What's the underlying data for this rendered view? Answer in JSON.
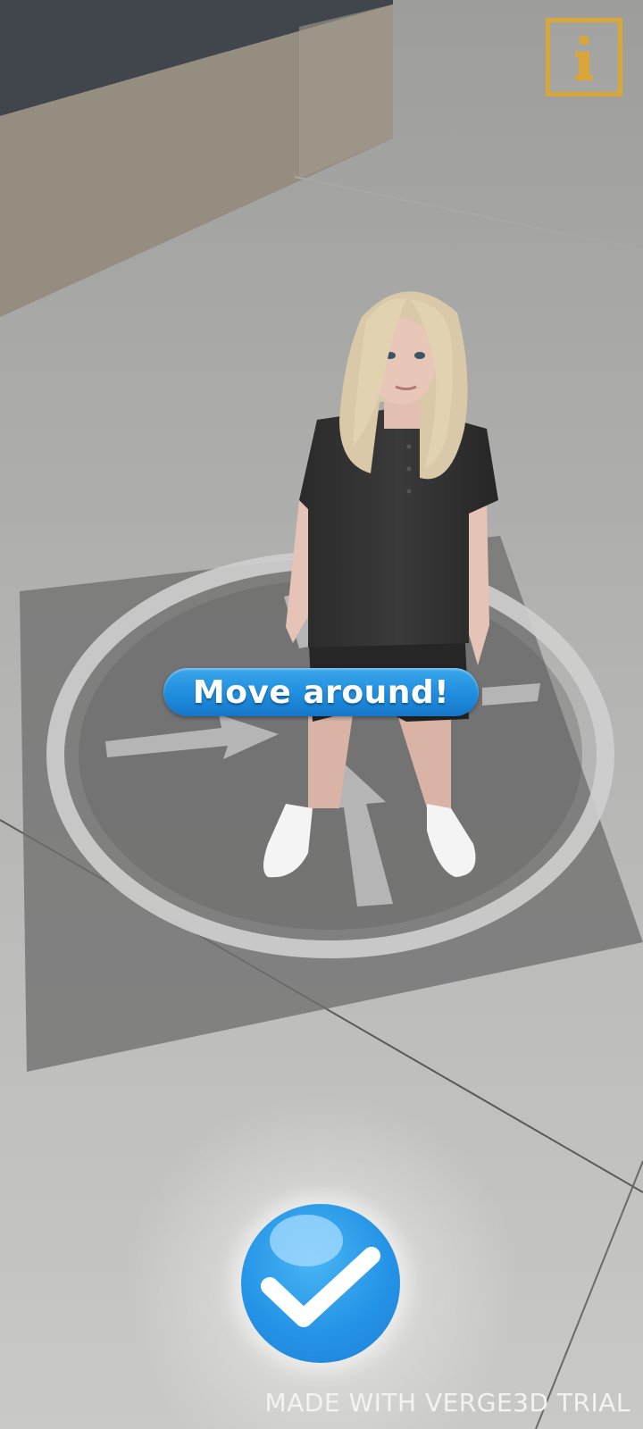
{
  "overlay": {
    "hint_text": "Move around!",
    "watermark_text": "MADE WITH VERGE3D TRIAL"
  },
  "controls": {
    "info_icon": "info-icon",
    "confirm_icon": "checkmark-icon"
  },
  "colors": {
    "accent_blue": "#2594e6",
    "info_gold": "#d9a63a",
    "watermark": "#f3f3f3"
  }
}
